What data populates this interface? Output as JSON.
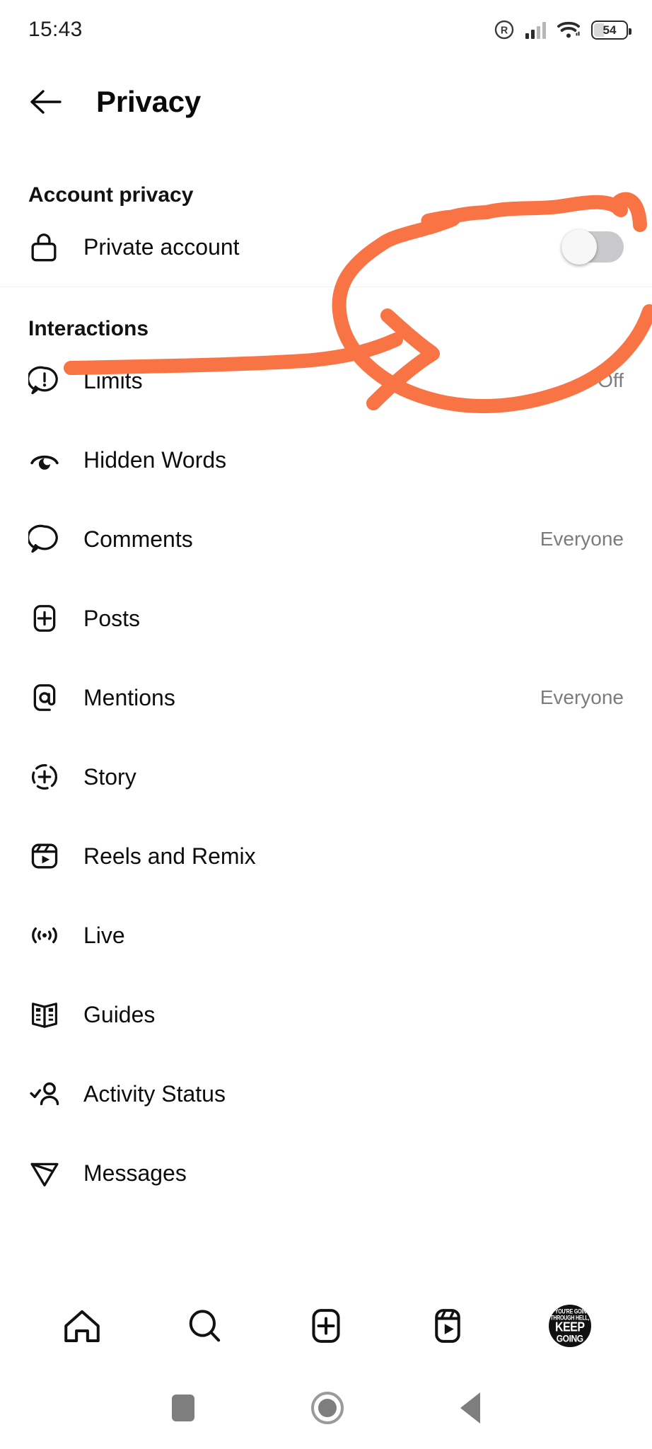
{
  "status_bar": {
    "time": "15:43",
    "battery_level": "54",
    "icons": [
      "registered-mark-icon",
      "cellular-signal-icon",
      "wifi-icon",
      "battery-icon"
    ]
  },
  "app_bar": {
    "back_icon": "arrow-left-icon",
    "title": "Privacy"
  },
  "sections": [
    {
      "title": "Account privacy",
      "rows": [
        {
          "icon": "lock-icon",
          "label": "Private account",
          "control": "toggle",
          "toggle_on": false
        }
      ]
    },
    {
      "title": "Interactions",
      "rows": [
        {
          "icon": "limits-icon",
          "label": "Limits",
          "value": "Off"
        },
        {
          "icon": "hidden-words-icon",
          "label": "Hidden Words",
          "value": ""
        },
        {
          "icon": "comment-icon",
          "label": "Comments",
          "value": "Everyone"
        },
        {
          "icon": "posts-plus-icon",
          "label": "Posts",
          "value": ""
        },
        {
          "icon": "mentions-at-icon",
          "label": "Mentions",
          "value": "Everyone"
        },
        {
          "icon": "story-plus-icon",
          "label": "Story",
          "value": ""
        },
        {
          "icon": "reels-icon",
          "label": "Reels and Remix",
          "value": ""
        },
        {
          "icon": "live-icon",
          "label": "Live",
          "value": ""
        },
        {
          "icon": "guides-book-icon",
          "label": "Guides",
          "value": ""
        },
        {
          "icon": "activity-status-icon",
          "label": "Activity Status",
          "value": ""
        },
        {
          "icon": "messages-plane-icon",
          "label": "Messages",
          "value": ""
        }
      ]
    }
  ],
  "bottom_nav": {
    "items": [
      {
        "icon": "home-icon",
        "name": "home"
      },
      {
        "icon": "search-icon",
        "name": "search"
      },
      {
        "icon": "create-icon",
        "name": "create"
      },
      {
        "icon": "reels-icon",
        "name": "reels"
      },
      {
        "icon": "avatar",
        "name": "profile"
      }
    ],
    "avatar_text": {
      "line1": "IF YOU'RE GOING",
      "line2": "THROUGH HELL,",
      "line3": "KEEP",
      "line4": "GOING"
    }
  },
  "system_nav": {
    "recents": "recents-square-icon",
    "home": "home-circle-icon",
    "back": "back-triangle-icon"
  },
  "annotation": {
    "color": "#F87445",
    "shapes": [
      "circle-highlight-around-toggle",
      "arrow-pointing-right-to-toggle"
    ]
  },
  "colors": {
    "accent_annotation": "#F87445",
    "text_primary": "#0d0d0d",
    "text_secondary": "#7c7c7c",
    "divider": "#efefef",
    "toggle_track_off": "#c9c9cb"
  }
}
